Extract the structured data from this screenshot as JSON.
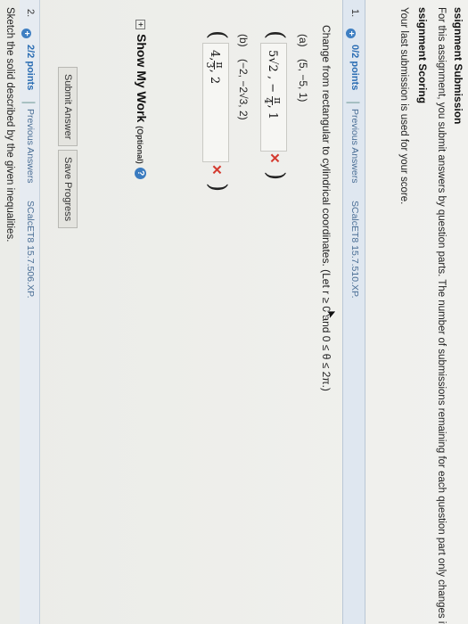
{
  "header": {
    "submission_title": "ssignment Submission",
    "submission_text": "For this assignment, you submit answers by question parts. The number of submissions remaining for each question part only changes if you s",
    "scoring_title": "ssignment Scoring",
    "scoring_text": "Your last submission is used for your score."
  },
  "question1": {
    "number": "1.",
    "points": "0/2 points",
    "separator": "|",
    "previous_answers": "Previous Answers",
    "code": "SCalcET8 15.7.510.XP.",
    "prompt": "Change from rectangular to cylindrical coordinates. (Let r ≥ 0 and 0 ≤ θ ≤ 2π.)",
    "part_a": {
      "label": "(a)",
      "point": "(5, −5, 1)",
      "answer_prefix": "5√2 , −",
      "frac_num": "π",
      "frac_den": "4",
      "answer_suffix": ", 1"
    },
    "part_b": {
      "label": "(b)",
      "point": "(−2, −2√3, 2)",
      "answer_prefix": "4,",
      "frac_num": "π",
      "frac_den": "3",
      "answer_suffix": ", 2"
    },
    "show_work": "Show My Work",
    "show_work_optional": "(Optional)",
    "help_symbol": "?",
    "submit_label": "Submit Answer",
    "save_label": "Save Progress",
    "x_mark": "✕"
  },
  "question2": {
    "number": "2.",
    "points": "2/2 points",
    "separator": "|",
    "previous_answers": "Previous Answers",
    "code": "SCalcET8 15.7.506.XP.",
    "prompt": "Sketch the solid described by the given inequalities."
  }
}
